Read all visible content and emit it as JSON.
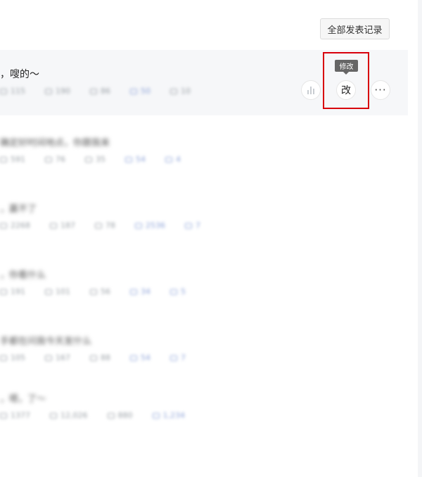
{
  "header": {
    "history_button": "全部发表记录"
  },
  "active_row": {
    "title": "，嗖的～",
    "tooltip": "修改",
    "edit_label": "改",
    "more_label": "···",
    "stats": [
      "115",
      "190",
      "86",
      "50",
      "10"
    ]
  },
  "rows": [
    {
      "title": "确定好时间地点，你跟我来",
      "stats": [
        "591",
        "76",
        "35",
        "54",
        "4"
      ]
    },
    {
      "title": "，赢不了",
      "stats": [
        "2268",
        "187",
        "78",
        "2536",
        "7"
      ]
    },
    {
      "title": "，你看什么",
      "stats": [
        "191",
        "101",
        "56",
        "34",
        "5"
      ]
    },
    {
      "title": "手都在问我今天发什么",
      "stats": [
        "105",
        "167",
        "88",
        "54",
        "7"
      ]
    },
    {
      "title": "，嗯，了～",
      "stats": [
        "1377",
        "12,026",
        "880",
        "1,234",
        ""
      ]
    }
  ],
  "colors": {
    "highlight": "#d8000c",
    "active_row_bg": "#f6f7f9",
    "blue_stat": "#8ea3d8"
  }
}
